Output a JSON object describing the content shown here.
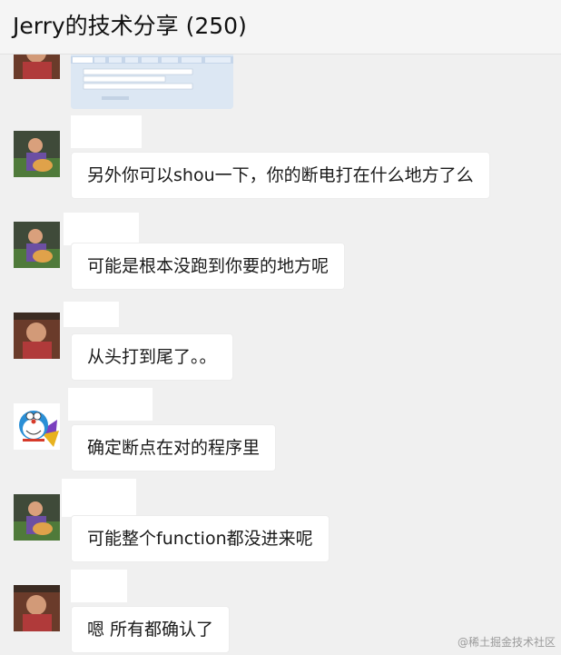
{
  "chat": {
    "title": "Jerry的技术分享 (250)"
  },
  "messages": [
    {
      "type": "image",
      "avatar_icon": "user-photo-icon"
    },
    {
      "type": "text",
      "avatar_icon": "user-photo-icon",
      "text": "另外你可以shou一下，你的断电打在什么地方了么"
    },
    {
      "type": "text",
      "avatar_icon": "user-photo-icon",
      "text": "可能是根本没跑到你要的地方呢"
    },
    {
      "type": "text",
      "avatar_icon": "user-photo-icon",
      "text": "从头打到尾了。。"
    },
    {
      "type": "text",
      "avatar_icon": "doraemon-avatar-icon",
      "text": "确定断点在对的程序里"
    },
    {
      "type": "text",
      "avatar_icon": "user-photo-icon",
      "text": "可能整个function都没进来呢"
    },
    {
      "type": "text",
      "avatar_icon": "user-photo-icon",
      "text": "嗯 所有都确认了"
    }
  ],
  "watermark": "@稀土掘金技术社区",
  "colors": {
    "bubble": "#ffffff",
    "background": "#f0f0f0",
    "header": "#f5f5f5"
  }
}
